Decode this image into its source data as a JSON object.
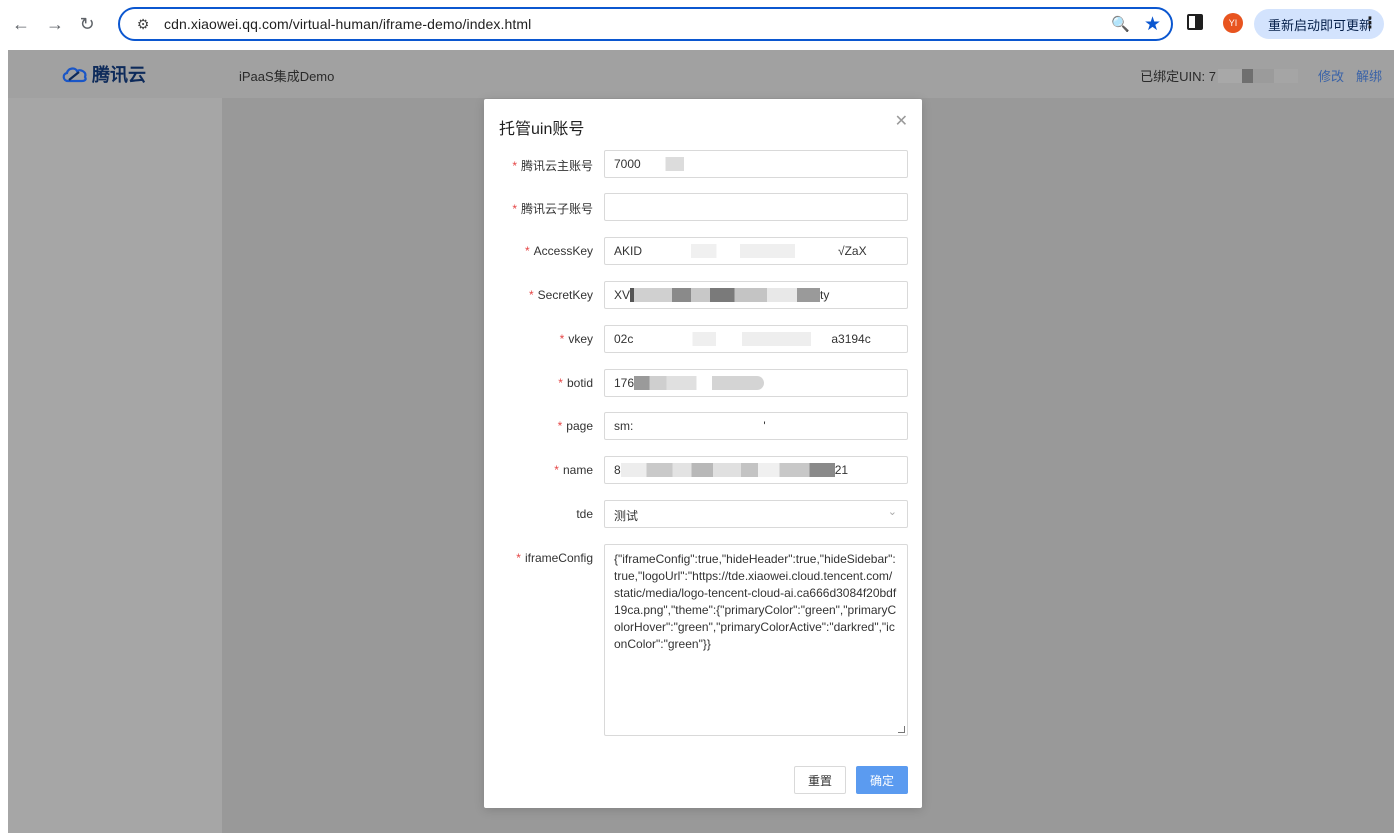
{
  "browser": {
    "url": "cdn.xiaowei.qq.com/virtual-human/iframe-demo/index.html",
    "avatar": "YI",
    "update_label": "重新启动即可更新"
  },
  "header": {
    "logo_text": "腾讯云",
    "app_name": "iPaaS集成Demo",
    "uin_label": "已绑定UIN: 7",
    "edit_link": "修改",
    "unbind_link": "解绑"
  },
  "modal": {
    "title": "托管uin账号",
    "fields": [
      {
        "label": "腾讯云主账号",
        "required": true,
        "value_prefix": "7000",
        "value_suffix": ""
      },
      {
        "label": "腾讯云子账号",
        "required": true,
        "value_prefix": "",
        "value_suffix": ""
      },
      {
        "label": "AccessKey",
        "required": true,
        "value_prefix": "AKID",
        "value_suffix": "√ZaX"
      },
      {
        "label": "SecretKey",
        "required": true,
        "value_prefix": "XV",
        "value_suffix": "ty"
      },
      {
        "label": "vkey",
        "required": true,
        "value_prefix": "02c",
        "value_suffix": "a3194c"
      },
      {
        "label": "botid",
        "required": true,
        "value_prefix": "176",
        "value_suffix": ""
      },
      {
        "label": "page",
        "required": true,
        "value_prefix": "sm:",
        "value_suffix": "'"
      },
      {
        "label": "name",
        "required": true,
        "value_prefix": "8",
        "value_suffix": "21"
      },
      {
        "label": "tde",
        "required": false,
        "value": "测试"
      },
      {
        "label": "iframeConfig",
        "required": true,
        "value": "{\"iframeConfig\":true,\"hideHeader\":true,\"hideSidebar\":true,\"logoUrl\":\"https://tde.xiaowei.cloud.tencent.com/static/media/logo-tencent-cloud-ai.ca666d3084f20bdf19ca.png\",\"theme\":{\"primaryColor\":\"green\",\"primaryColorHover\":\"green\",\"primaryColorActive\":\"darkred\",\"iconColor\":\"green\"}}"
      }
    ],
    "reset_label": "重置",
    "confirm_label": "确定"
  },
  "colors": {
    "accent": "#0b57d0",
    "primary_button": "#5b9bf0",
    "required_mark": "#e54545"
  }
}
